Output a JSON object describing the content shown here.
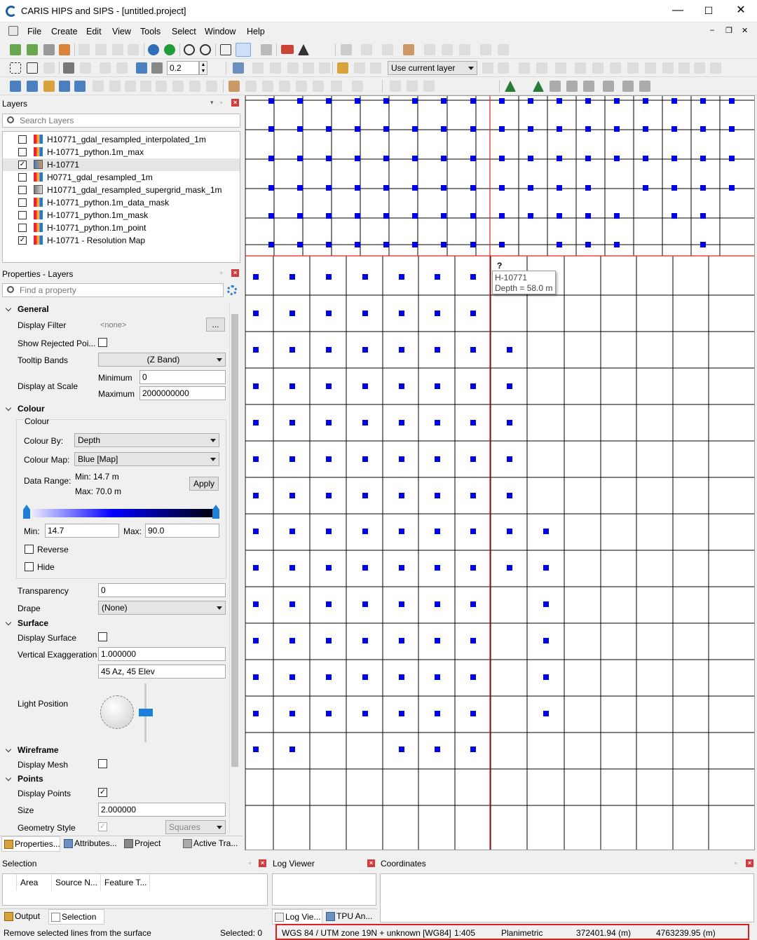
{
  "window": {
    "title": "CARIS HIPS and SIPS - [untitled.project]",
    "minimize": "—",
    "maximize": "☐",
    "close": "✕"
  },
  "menu": [
    "File",
    "Create",
    "Edit",
    "View",
    "Tools",
    "Select",
    "Window",
    "Help"
  ],
  "toolbar": {
    "snap_value": "0.2",
    "layer_combo": "Use current layer"
  },
  "layers_panel": {
    "title": "Layers",
    "search_placeholder": "Search Layers",
    "items": [
      {
        "label": "H10771_gdal_resampled_interpolated_1m",
        "checked": false,
        "icon": "raster-icon"
      },
      {
        "label": "H-10771_python.1m_max",
        "checked": false,
        "icon": "raster-icon"
      },
      {
        "label": "H-10771",
        "checked": true,
        "icon": "grid-icon",
        "selected": true
      },
      {
        "label": "H0771_gdal_resampled_1m",
        "checked": false,
        "icon": "raster-icon"
      },
      {
        "label": "H10771_gdal_resampled_supergrid_mask_1m",
        "checked": false,
        "icon": "grayscale-icon"
      },
      {
        "label": "H-10771_python.1m_data_mask",
        "checked": false,
        "icon": "raster-icon"
      },
      {
        "label": "H-10771_python.1m_mask",
        "checked": false,
        "icon": "raster-icon"
      },
      {
        "label": "H-10771_python.1m_point",
        "checked": false,
        "icon": "raster-icon"
      },
      {
        "label": "H-10771 - Resolution Map",
        "checked": true,
        "icon": "raster-icon"
      }
    ]
  },
  "properties_panel": {
    "title": "Properties - Layers",
    "search_placeholder": "Find a property",
    "general": {
      "header": "General",
      "display_filter_label": "Display Filter",
      "display_filter_value": "<none>",
      "ellipsis": "...",
      "show_rejected_label": "Show Rejected Poi...",
      "tooltip_bands_label": "Tooltip Bands",
      "tooltip_bands_value": "(Z Band)",
      "display_scale_label": "Display at Scale",
      "minimum_label": "Minimum",
      "minimum_value": "0",
      "maximum_label": "Maximum",
      "maximum_value": "2000000000"
    },
    "colour": {
      "header": "Colour",
      "group_label": "Colour",
      "colour_by_label": "Colour By:",
      "colour_by_value": "Depth",
      "colour_map_label": "Colour Map:",
      "colour_map_value": "Blue [Map]",
      "data_range_label": "Data Range:",
      "range_min": "Min:  14.7 m",
      "range_max": "Max:  70.0 m",
      "apply": "Apply",
      "min_label": "Min:",
      "min_value": "14.7",
      "max_label": "Max:",
      "max_value": "90.0",
      "reverse": "Reverse",
      "hide": "Hide",
      "transparency_label": "Transparency",
      "transparency_value": "0",
      "drape_label": "Drape",
      "drape_value": "(None)"
    },
    "surface": {
      "header": "Surface",
      "display_surface": "Display Surface",
      "vexag_label": "Vertical Exaggeration",
      "vexag_value": "1.000000",
      "light_value": "45  Az, 45 Elev",
      "light_label": "Light Position"
    },
    "wireframe": {
      "header": "Wireframe",
      "display_mesh": "Display Mesh"
    },
    "points": {
      "header": "Points",
      "display_points": "Display Points",
      "size_label": "Size",
      "size_value": "2.000000",
      "geometry_label": "Geometry Style",
      "geometry_value": "Squares"
    }
  },
  "left_tabs": [
    "Properties...",
    "Attributes...",
    "Project",
    "Active Tra..."
  ],
  "map": {
    "tooltip_layer": "H-10771",
    "tooltip_depth": "Depth = 58.0 m",
    "cursor": "?"
  },
  "selection_panel": {
    "title": "Selection",
    "columns": [
      "Area",
      "Source N...",
      "Feature T..."
    ],
    "tabs": [
      "Output",
      "Selection"
    ]
  },
  "log_panel": {
    "title": "Log Viewer",
    "tabs": [
      "Log Vie...",
      "TPU An..."
    ]
  },
  "coords_panel": {
    "title": "Coordinates"
  },
  "status": {
    "message": "Remove selected lines from the surface",
    "selected": "Selected: 0",
    "crs": "WGS 84 / UTM zone 19N + unknown [WG84]",
    "scale": "1:405",
    "mode": "Planimetric",
    "easting": "372401.94 (m)",
    "northing": "4763239.95 (m)"
  },
  "colors": {
    "point": "#0000e6",
    "highlight": "#e0201e",
    "grid": "#000000"
  }
}
